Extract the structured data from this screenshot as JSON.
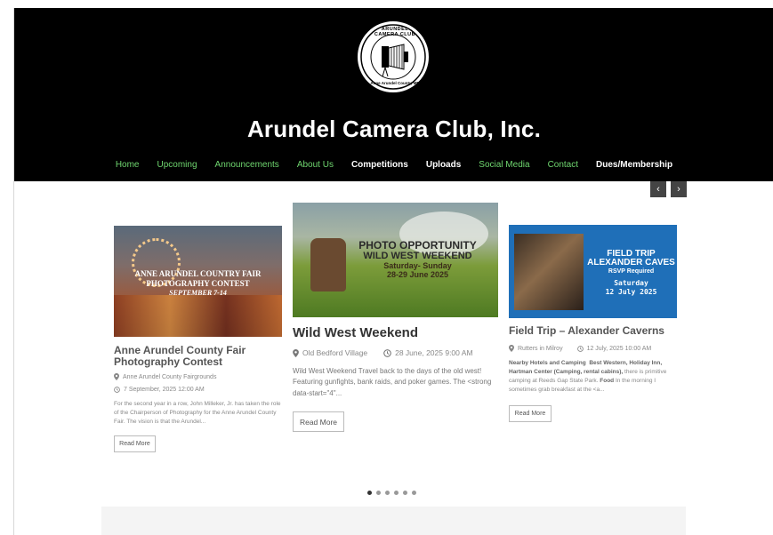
{
  "site": {
    "title": "Arundel Camera Club, Inc.",
    "logo_text_top": "ARUNDEL CAMERA CLUB",
    "logo_text_bottom": "Anne Arundel County, MD"
  },
  "nav": [
    {
      "label": "Home",
      "style": "green"
    },
    {
      "label": "Upcoming",
      "style": "green"
    },
    {
      "label": "Announcements",
      "style": "green"
    },
    {
      "label": "About Us",
      "style": "green"
    },
    {
      "label": "Competitions",
      "style": "white"
    },
    {
      "label": "Uploads",
      "style": "white"
    },
    {
      "label": "Social Media",
      "style": "green"
    },
    {
      "label": "Contact",
      "style": "green"
    },
    {
      "label": "Dues/Membership",
      "style": "white"
    }
  ],
  "slider": {
    "prev_label": "‹",
    "next_label": "›",
    "dot_count": 6,
    "active_dot": 0
  },
  "cards": [
    {
      "image_text": [
        "ANNE ARUNDEL COUNTRY FAIR",
        "PHOTOGRAPHY CONTEST",
        "SEPTEMBER 7-14"
      ],
      "title": "Anne Arundel County Fair Photography Contest",
      "location": "Anne Arundel County Fairgrounds",
      "date": "7 September, 2025 12:00 AM",
      "excerpt": "For the second year in  a row, John Milleker, Jr. has taken the role of the Chairperson of Photography for the Anne Arundel County Fair. The vision is that the Arundel...",
      "read_more": "Read More"
    },
    {
      "image_text": [
        "PHOTO OPPORTUNITY",
        "WILD WEST WEEKEND",
        "Saturday- Sunday",
        "28-29 June 2025"
      ],
      "title": "Wild West Weekend",
      "location": "Old Bedford Village",
      "date": "28 June, 2025 9:00 AM",
      "excerpt": "Wild West Weekend Travel back to the days of the old west! Featuring gunfights, bank raids, and poker games. The <strong data-start=\"4\"...",
      "read_more": "Read More"
    },
    {
      "image_text": [
        "FIELD TRIP",
        "ALEXANDER CAVES",
        "RSVP Required",
        "Saturday",
        "12 July 2025"
      ],
      "title": "Field Trip – Alexander Caverns",
      "location": "Rutters in Milroy",
      "date": "12 July, 2025 10:00 AM",
      "excerpt_bold_1": "Nearby Hotels and Camping",
      "excerpt_bold_2": "Best Western, Holiday Inn, Hartman Center (Camping, rental cabins),",
      "excerpt_plain_1": " there is primitive camping at Reeds Gap State Park. ",
      "excerpt_bold_3": "Food",
      "excerpt_plain_2": " In the morning I sometimes grab breakfast at the <a...",
      "read_more": "Read More"
    }
  ],
  "colors": {
    "header_bg": "#000000",
    "nav_green": "#6fd66f",
    "nav_white": "#ffffff",
    "card3_image_bg": "#1f6fb8"
  }
}
